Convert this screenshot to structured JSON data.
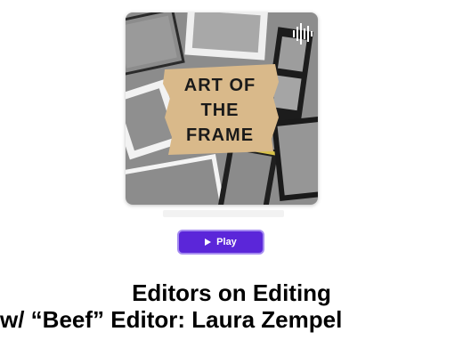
{
  "podcast": {
    "cover_title_lines": [
      "ART OF",
      "THE",
      "FRAME"
    ],
    "cover_icon": "audio-waveform-icon",
    "cover_colors": {
      "background": "#8a8a8a",
      "tape": "#d9b98a",
      "frame": "#f1f1f1",
      "film": "#1c1c1c"
    }
  },
  "player": {
    "play_label": "Play",
    "play_icon": "play-icon",
    "accent_color": "#5b26d9"
  },
  "episode": {
    "title_line1": "Editors on Editing",
    "title_line2": "w/ “Beef” Editor: Laura Zempel"
  }
}
